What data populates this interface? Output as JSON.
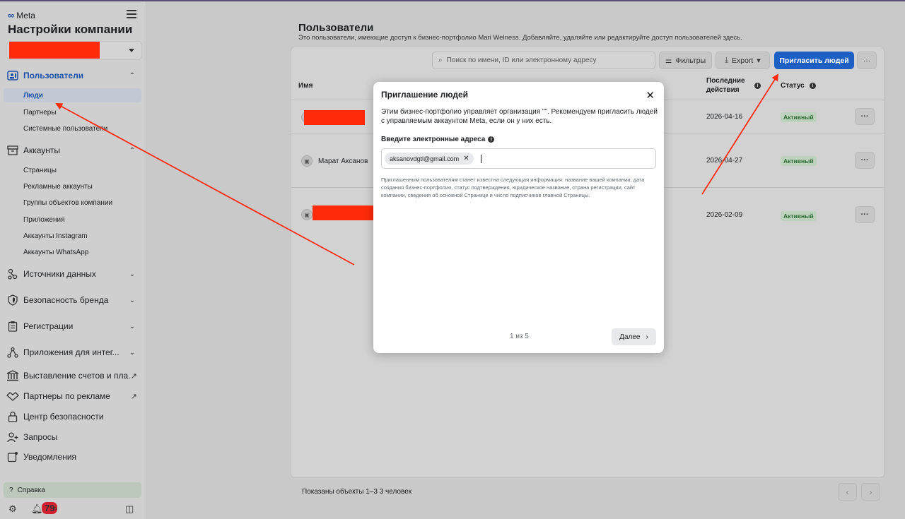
{
  "brand": "Meta",
  "sidebar": {
    "title": "Настройки компании",
    "sections": [
      {
        "label": "Пользователи",
        "icon": "users-icon"
      },
      {
        "label": "Аккаунты",
        "icon": "accounts-icon"
      },
      {
        "label": "Источники данных",
        "icon": "data-sources-icon"
      },
      {
        "label": "Безопасность бренда",
        "icon": "shield-icon"
      },
      {
        "label": "Регистрации",
        "icon": "clipboard-icon"
      },
      {
        "label": "Приложения для интег...",
        "icon": "integrations-icon"
      },
      {
        "label": "Выставление счетов и пла...",
        "icon": "bank-icon"
      },
      {
        "label": "Партнеры по рекламе",
        "icon": "handshake-icon"
      },
      {
        "label": "Центр безопасности",
        "icon": "lock-icon"
      },
      {
        "label": "Запросы",
        "icon": "person-plus-icon"
      },
      {
        "label": "Уведомления",
        "icon": "notification-icon"
      }
    ],
    "users_items": [
      "Люди",
      "Партнеры",
      "Системные пользователи"
    ],
    "accounts_items": [
      "Страницы",
      "Рекламные аккаунты",
      "Группы объектов компании",
      "Приложения",
      "Аккаунты Instagram",
      "Аккаунты WhatsApp"
    ],
    "help": "Справка",
    "notifications_count": "79"
  },
  "main": {
    "title": "Пользователи",
    "subtitle": "Это пользователи, имеющие доступ к бизнес-портфолио Mari Welness. Добавляйте, удаляйте или редактируйте доступ пользователей здесь.",
    "search_placeholder": "Поиск по имени, ID или электронному адресу",
    "filters_label": "Фильтры",
    "export_label": "Export",
    "invite_label": "Пригласить людей",
    "more_label": "···",
    "columns": {
      "name": "Имя",
      "last_actions": "Последние действия",
      "status": "Статус"
    },
    "rows": [
      {
        "name": "",
        "date": "2026-04-16",
        "status": "Активный"
      },
      {
        "name": "Марат Аксанов",
        "date": "2026-04-27",
        "status": "Активный"
      },
      {
        "name": "",
        "date": "2026-02-09",
        "status": "Активный"
      }
    ],
    "footer": "Показаны объекты 1–3 3 человек"
  },
  "modal": {
    "title": "Приглашение людей",
    "description": "Этим бизнес-портфолио управляет организация \"\". Рекомендуем пригласить людей с управляемым аккаунтом Meta, если он у них есть.",
    "email_label": "Введите электронные адреса",
    "email_chip": "aksanovdgtl@gmail.com",
    "note": "Приглашенным пользователям станет известна следующая информация: название вашей компании, дата создания бизнес-портфолио, статус подтверждения, юридическое название, страна регистрации, сайт компании, сведения об основной Странице и число подписчиков главной Страницы.",
    "page_indicator": "1 из 5",
    "next_label": "Далее"
  },
  "colors": {
    "primary": "#1d5fc2",
    "annotation": "#ff2a0a",
    "active_status": "#2e6b35"
  }
}
